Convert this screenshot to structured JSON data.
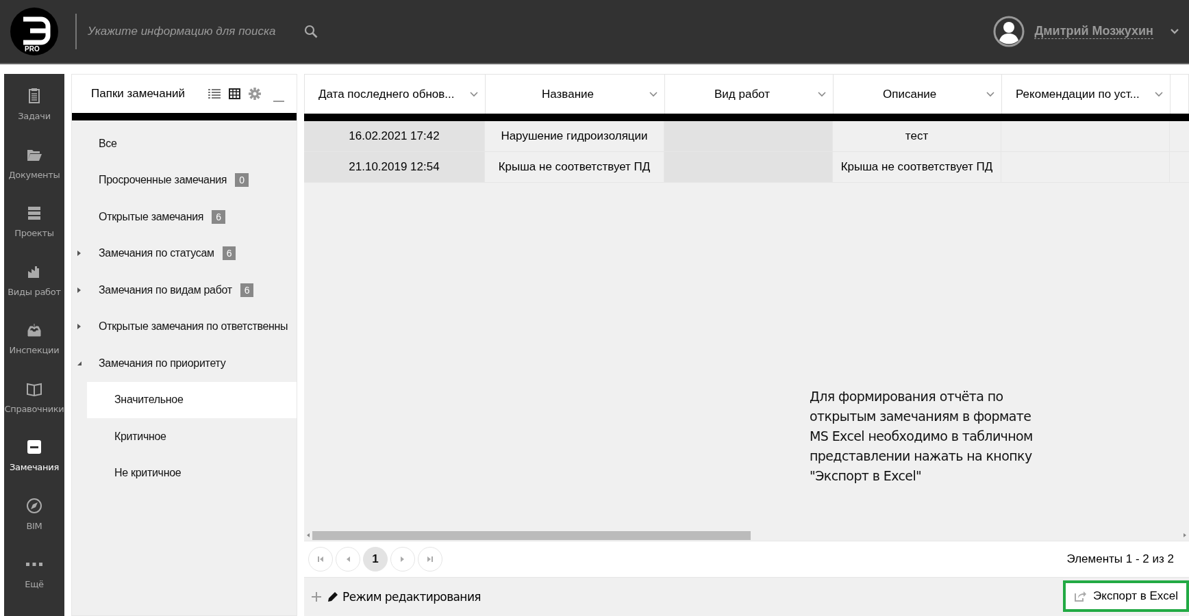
{
  "header": {
    "logo_caption": "PRO",
    "search": {
      "placeholder": "Укажите информацию для поиска"
    },
    "user": {
      "name": "Дмитрий Мозжухин"
    }
  },
  "nav": [
    {
      "label": "Задачи",
      "selected": false
    },
    {
      "label": "Документы",
      "selected": false
    },
    {
      "label": "Проекты",
      "selected": false
    },
    {
      "label": "Виды работ",
      "selected": false
    },
    {
      "label": "Инспекции",
      "selected": false
    },
    {
      "label": "Справочники",
      "selected": false
    },
    {
      "label": "Замечания",
      "selected": true
    },
    {
      "label": "BIM",
      "selected": false
    },
    {
      "label": "Ещё",
      "selected": false
    }
  ],
  "folders": {
    "title": "Папки замечаний",
    "items": [
      {
        "label": "Все",
        "selected": false
      },
      {
        "label": "Просроченные замечания",
        "badge": "0",
        "selected": false
      },
      {
        "label": "Открытые замечания",
        "badge": "6",
        "selected": false
      },
      {
        "label": "Замечания по статусам",
        "badge": "6",
        "expanded": false,
        "selected": false
      },
      {
        "label": "Замечания по видам работ",
        "badge": "6",
        "expanded": false,
        "selected": false
      },
      {
        "label": "Открытые замечания по ответственны",
        "expanded": false,
        "selected": false
      },
      {
        "label": "Замечания по приоритету",
        "expanded": true,
        "selected": false,
        "children": [
          {
            "label": "Значительное",
            "selected": true
          },
          {
            "label": "Критичное",
            "selected": false
          },
          {
            "label": "Не критичное",
            "selected": false
          }
        ]
      }
    ]
  },
  "table": {
    "columns": [
      "Дата последнего обнов...",
      "Название",
      "Вид работ",
      "Описание",
      "Рекомендации по уст..."
    ],
    "rows": [
      [
        "16.02.2021 17:42",
        "Нарушение гидроизоляции",
        "",
        "тест",
        ""
      ],
      [
        "21.10.2019 12:54",
        "Крыша не соответствует ПД",
        "",
        "Крыша не соответствует ПД",
        ""
      ]
    ]
  },
  "note": "Для формирования отчёта по открытым замечаниям в формате MS Excel необходимо в табличном представлении нажать на кнопку \"Экспорт в Excel\"",
  "pager": {
    "pages": [
      {
        "label": "1",
        "selected": true
      }
    ],
    "summary": "Элементы 1 - 2 из 2"
  },
  "footer": {
    "edit_mode": "Режим редактирования",
    "export": "Экспорт в Excel"
  }
}
